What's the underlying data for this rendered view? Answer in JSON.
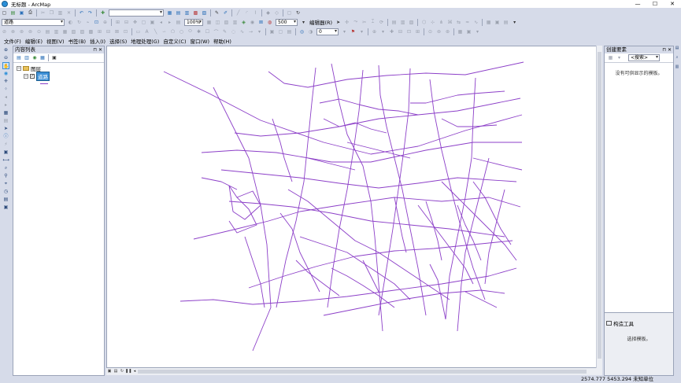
{
  "window": {
    "title": "无标题 - ArcMap",
    "minimize": "—",
    "maximize": "☐",
    "close": "✕"
  },
  "toolbar1": {
    "scale_value": "",
    "icons": [
      "new-icon",
      "open-icon",
      "save-icon",
      "print-icon",
      "cut-icon",
      "copy-icon",
      "paste-icon",
      "delete-icon",
      "undo-icon",
      "redo-icon",
      "add-data-icon"
    ]
  },
  "toolbar2": {
    "layer_select": "道路",
    "zoom_percent": "100%",
    "scale_box": "500",
    "editor_label": "编辑器(R)"
  },
  "toolbar3": {
    "offset_value": "0"
  },
  "menu": {
    "items": [
      "文件(F)",
      "编辑(E)",
      "视图(V)",
      "书签(B)",
      "插入(I)",
      "选择(S)",
      "地理处理(G)",
      "自定义(C)",
      "窗口(W)",
      "帮助(H)"
    ]
  },
  "toc": {
    "title": "内容列表",
    "pins": "⊓ ✕",
    "data_frame": "图层",
    "layer": "道路"
  },
  "right_panel": {
    "title": "创建要素",
    "pins": "⊓ ✕",
    "search_placeholder": "<搜索>",
    "empty_message": "没有可供显示的模板。",
    "construct_title": "构造工具",
    "construct_message": "选择模板。"
  },
  "status": {
    "coords": "2574.777  5453.294 未知单位"
  },
  "colors": {
    "road": "#8c3fc8",
    "chrome": "#d6dbe9",
    "selection": "#3c8fd6"
  }
}
